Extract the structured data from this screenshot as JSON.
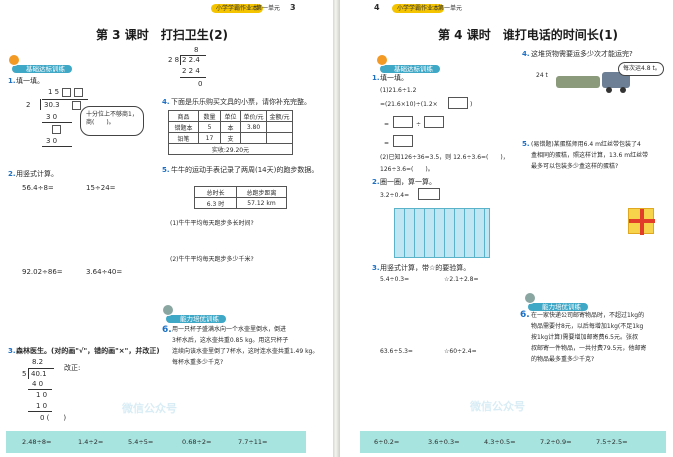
{
  "left_page": {
    "header": {
      "tag": "小学学霸作业本",
      "unit": "第一单元",
      "page_num": "3"
    },
    "title": "第 3 课时　打扫卫生(2)",
    "section_basic": "基础达标训练",
    "section_advanced": "能力培优训练",
    "q1_label": "1.",
    "q1_text": "填一填。",
    "q1_division": {
      "quotient_top": "1 5",
      "dividend": "30.3",
      "divisor": "2",
      "rows": [
        "3 0",
        "3 0"
      ],
      "bubble": "十分位上不够商1，商(　　)。"
    },
    "q2_label": "2.",
    "q2_text": "用竖式计算。",
    "q2_items": [
      "56.4÷8=",
      "15÷24=",
      "92.02÷86=",
      "3.64÷40="
    ],
    "q3_label": "3.",
    "q3_text": "森林医生。(对的画\"√\"，错的画\"×\"，并改正)",
    "q3_division": {
      "quotient": "8.2",
      "dividend": "40.1",
      "divisor": "5",
      "rows": [
        "4 0",
        "1 0",
        "1 0",
        "0"
      ],
      "correct_label": "改正:",
      "paren": "0 (　　)"
    },
    "top_division": {
      "rows": [
        "8",
        "2 8",
        "2 2.4",
        "2 2 4",
        "0"
      ]
    },
    "q4_label": "4.",
    "q4_text": "下面是乐乐购买文具的小票，请你补充完整。",
    "receipt": {
      "headers": [
        "商品",
        "数量",
        "单位",
        "单价/元",
        "金额/元"
      ],
      "rows": [
        [
          "错题本",
          "5",
          "本",
          "3.80",
          ""
        ],
        [
          "铅笔",
          "17",
          "支",
          "",
          ""
        ]
      ],
      "footer": "实收:29.20元"
    },
    "q5_label": "5.",
    "q5_text": "牛牛的运动手表记录了两周(14天)的跑步数据。",
    "run_table": {
      "headers": [
        "总时长",
        "总跑步距离"
      ],
      "values": [
        "6.3 时",
        "57.12 km"
      ]
    },
    "q5_sub": [
      "(1)牛牛平均每天跑步多长时间?",
      "(2)牛牛平均每天跑步多少千米?"
    ],
    "q6_label": "6.",
    "q6_text": [
      "用一只杯子盛满水向一个水壶里倒水，倒进",
      "3杯水后，这水壶共重0.85 kg。用这只杯子",
      "连续向该水壶里倒了7杯水，这时连水壶共重1.49 kg。",
      "每杯水重多少千克?"
    ],
    "bottom_items": [
      "2.48÷8=",
      "1.4÷2=",
      "5.4÷5=",
      "0.68÷2=",
      "7.7÷11="
    ],
    "watermark": "微信公众号"
  },
  "right_page": {
    "header": {
      "page_num": "4",
      "tag": "小学学霸作业本",
      "unit": "第一单元"
    },
    "title": "第 4 课时　谁打电话的时间长(1)",
    "section_basic": "基础达标训练",
    "section_advanced": "能力培优训练",
    "q1_label": "1.",
    "q1_text": "填一填。",
    "q1_parts": [
      "(1)21.6÷1.2",
      "=(21.6×10)÷(1.2×",
      ")",
      "÷",
      "=",
      "(2)已知126÷36=3.5，则 12.6÷3.6=(　　)，",
      "126÷3.6=(　　)。"
    ],
    "q2_label": "2.",
    "q2_text": "圈一圈，算一算。",
    "q2_expr": "3.2÷0.4=",
    "q3_label": "3.",
    "q3_text": "用竖式计算，带☆的要验算。",
    "q3_items": [
      "5.4÷0.3=",
      "☆2.1÷2.8=",
      "63.6÷5.3=",
      "☆60÷2.4="
    ],
    "q4_label": "4.",
    "q4_text": "这堆货物需要运多少次才能运完?",
    "truck": {
      "cargo": "24 t",
      "speech": "每次运4.8 t。"
    },
    "q5_label": "5.",
    "q5_text": [
      "(易错题)某蛋糕师用6.4 m红丝带包装了4",
      "盒相同的蛋糕，照这样计算，13.6 m红丝带",
      "最多可以包装多少盒这样的蛋糕?"
    ],
    "q6_label": "6.",
    "q6_text": [
      "在一家快递公司邮寄物品时，不超过1kg的",
      "物品需要付8元，以后每增加1kg(不足1kg",
      "按1kg计算)需要增加邮寄费6.5元。张叔",
      "叔邮寄一件物品，一共付费79.5元，他邮寄",
      "的物品最多重多少千克?"
    ],
    "bottom_items": [
      "6÷0.2=",
      "3.6÷0.3=",
      "4.3÷0.5=",
      "7.2÷0.9=",
      "7.5÷2.5="
    ],
    "watermark": "微信公众号"
  },
  "colors": {
    "section_blue": "#3fa8c7",
    "bar_teal": "#a8e4df",
    "header_yellow": "#f4c400",
    "number_blue": "#1a6fc4",
    "number_red": "#d9351c"
  }
}
